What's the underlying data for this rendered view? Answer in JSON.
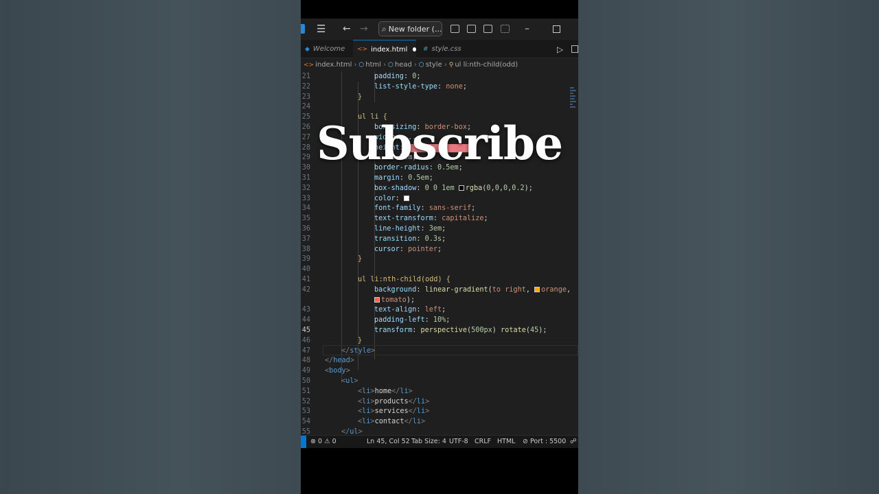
{
  "titlebar": {
    "search_label": "New folder (...",
    "window_buttons": [
      "minimize-icon",
      "maximize-icon"
    ]
  },
  "tabs": [
    {
      "label": "Welcome",
      "icon": "vscode-icon",
      "active": false
    },
    {
      "label": "index.html",
      "icon": "html-file-icon",
      "active": true,
      "modified": true
    },
    {
      "label": "style.css",
      "icon": "css-file-icon",
      "active": false
    }
  ],
  "breadcrumbs": [
    "index.html",
    "html",
    "head",
    "style",
    "ul li:nth-child(odd)"
  ],
  "code_lines": [
    {
      "n": "21",
      "text": "padding: 0;"
    },
    {
      "n": "22",
      "text": "list-style-type: none;"
    },
    {
      "n": "23",
      "text": "}"
    },
    {
      "n": "24",
      "text": ""
    },
    {
      "n": "25",
      "text": "ul li {"
    },
    {
      "n": "26",
      "text": "box-sizing: border-box;"
    },
    {
      "n": "27",
      "text": "width: ..."
    },
    {
      "n": "28",
      "text": "height: ..."
    },
    {
      "n": "29",
      "text": "... 0.5em;"
    },
    {
      "n": "30",
      "text": "border-radius: 0.5em;"
    },
    {
      "n": "31",
      "text": "margin: 0.5em;"
    },
    {
      "n": "32",
      "text": "box-shadow: 0 0 1em rgba(0,0,0,0.2);"
    },
    {
      "n": "33",
      "text": "color: "
    },
    {
      "n": "34",
      "text": "font-family: sans-serif;"
    },
    {
      "n": "35",
      "text": "text-transform: capitalize;"
    },
    {
      "n": "36",
      "text": "line-height: 3em;"
    },
    {
      "n": "37",
      "text": "transition: 0.3s;"
    },
    {
      "n": "38",
      "text": "cursor: pointer;"
    },
    {
      "n": "39",
      "text": "}"
    },
    {
      "n": "40",
      "text": ""
    },
    {
      "n": "41",
      "text": "ul li:nth-child(odd) {"
    },
    {
      "n": "42",
      "text": "background: linear-gradient(to right, orange,"
    },
    {
      "n": "",
      "text": "tomato);"
    },
    {
      "n": "43",
      "text": "text-align: left;"
    },
    {
      "n": "44",
      "text": "padding-left: 10%;"
    },
    {
      "n": "45",
      "text": "transform: perspective(500px) rotate(45);"
    },
    {
      "n": "46",
      "text": "}"
    },
    {
      "n": "47",
      "text": "</style>"
    },
    {
      "n": "48",
      "text": "</head>"
    },
    {
      "n": "49",
      "text": "<body>"
    },
    {
      "n": "50",
      "text": "<ul>"
    },
    {
      "n": "51",
      "text": "<li>home</li>"
    },
    {
      "n": "52",
      "text": "<li>products</li>"
    },
    {
      "n": "53",
      "text": "<li>services</li>"
    },
    {
      "n": "54",
      "text": "<li>contact</li>"
    },
    {
      "n": "55",
      "text": "</ul>"
    }
  ],
  "current_line": "45",
  "statusbar": {
    "errors": "0",
    "warnings": "0",
    "position": "Ln 45, Col 52",
    "tab_size": "Tab Size: 4",
    "encoding": "UTF-8",
    "eol": "CRLF",
    "language": "HTML",
    "port": "Port : 5500"
  },
  "overlay_text": "Subscribe",
  "colors": {
    "editor_bg": "#1f1f1f",
    "accent": "#0078d4",
    "orange_swatch": "#ffa500",
    "tomato_swatch": "#ff6347",
    "redact": "#ea7a80"
  }
}
